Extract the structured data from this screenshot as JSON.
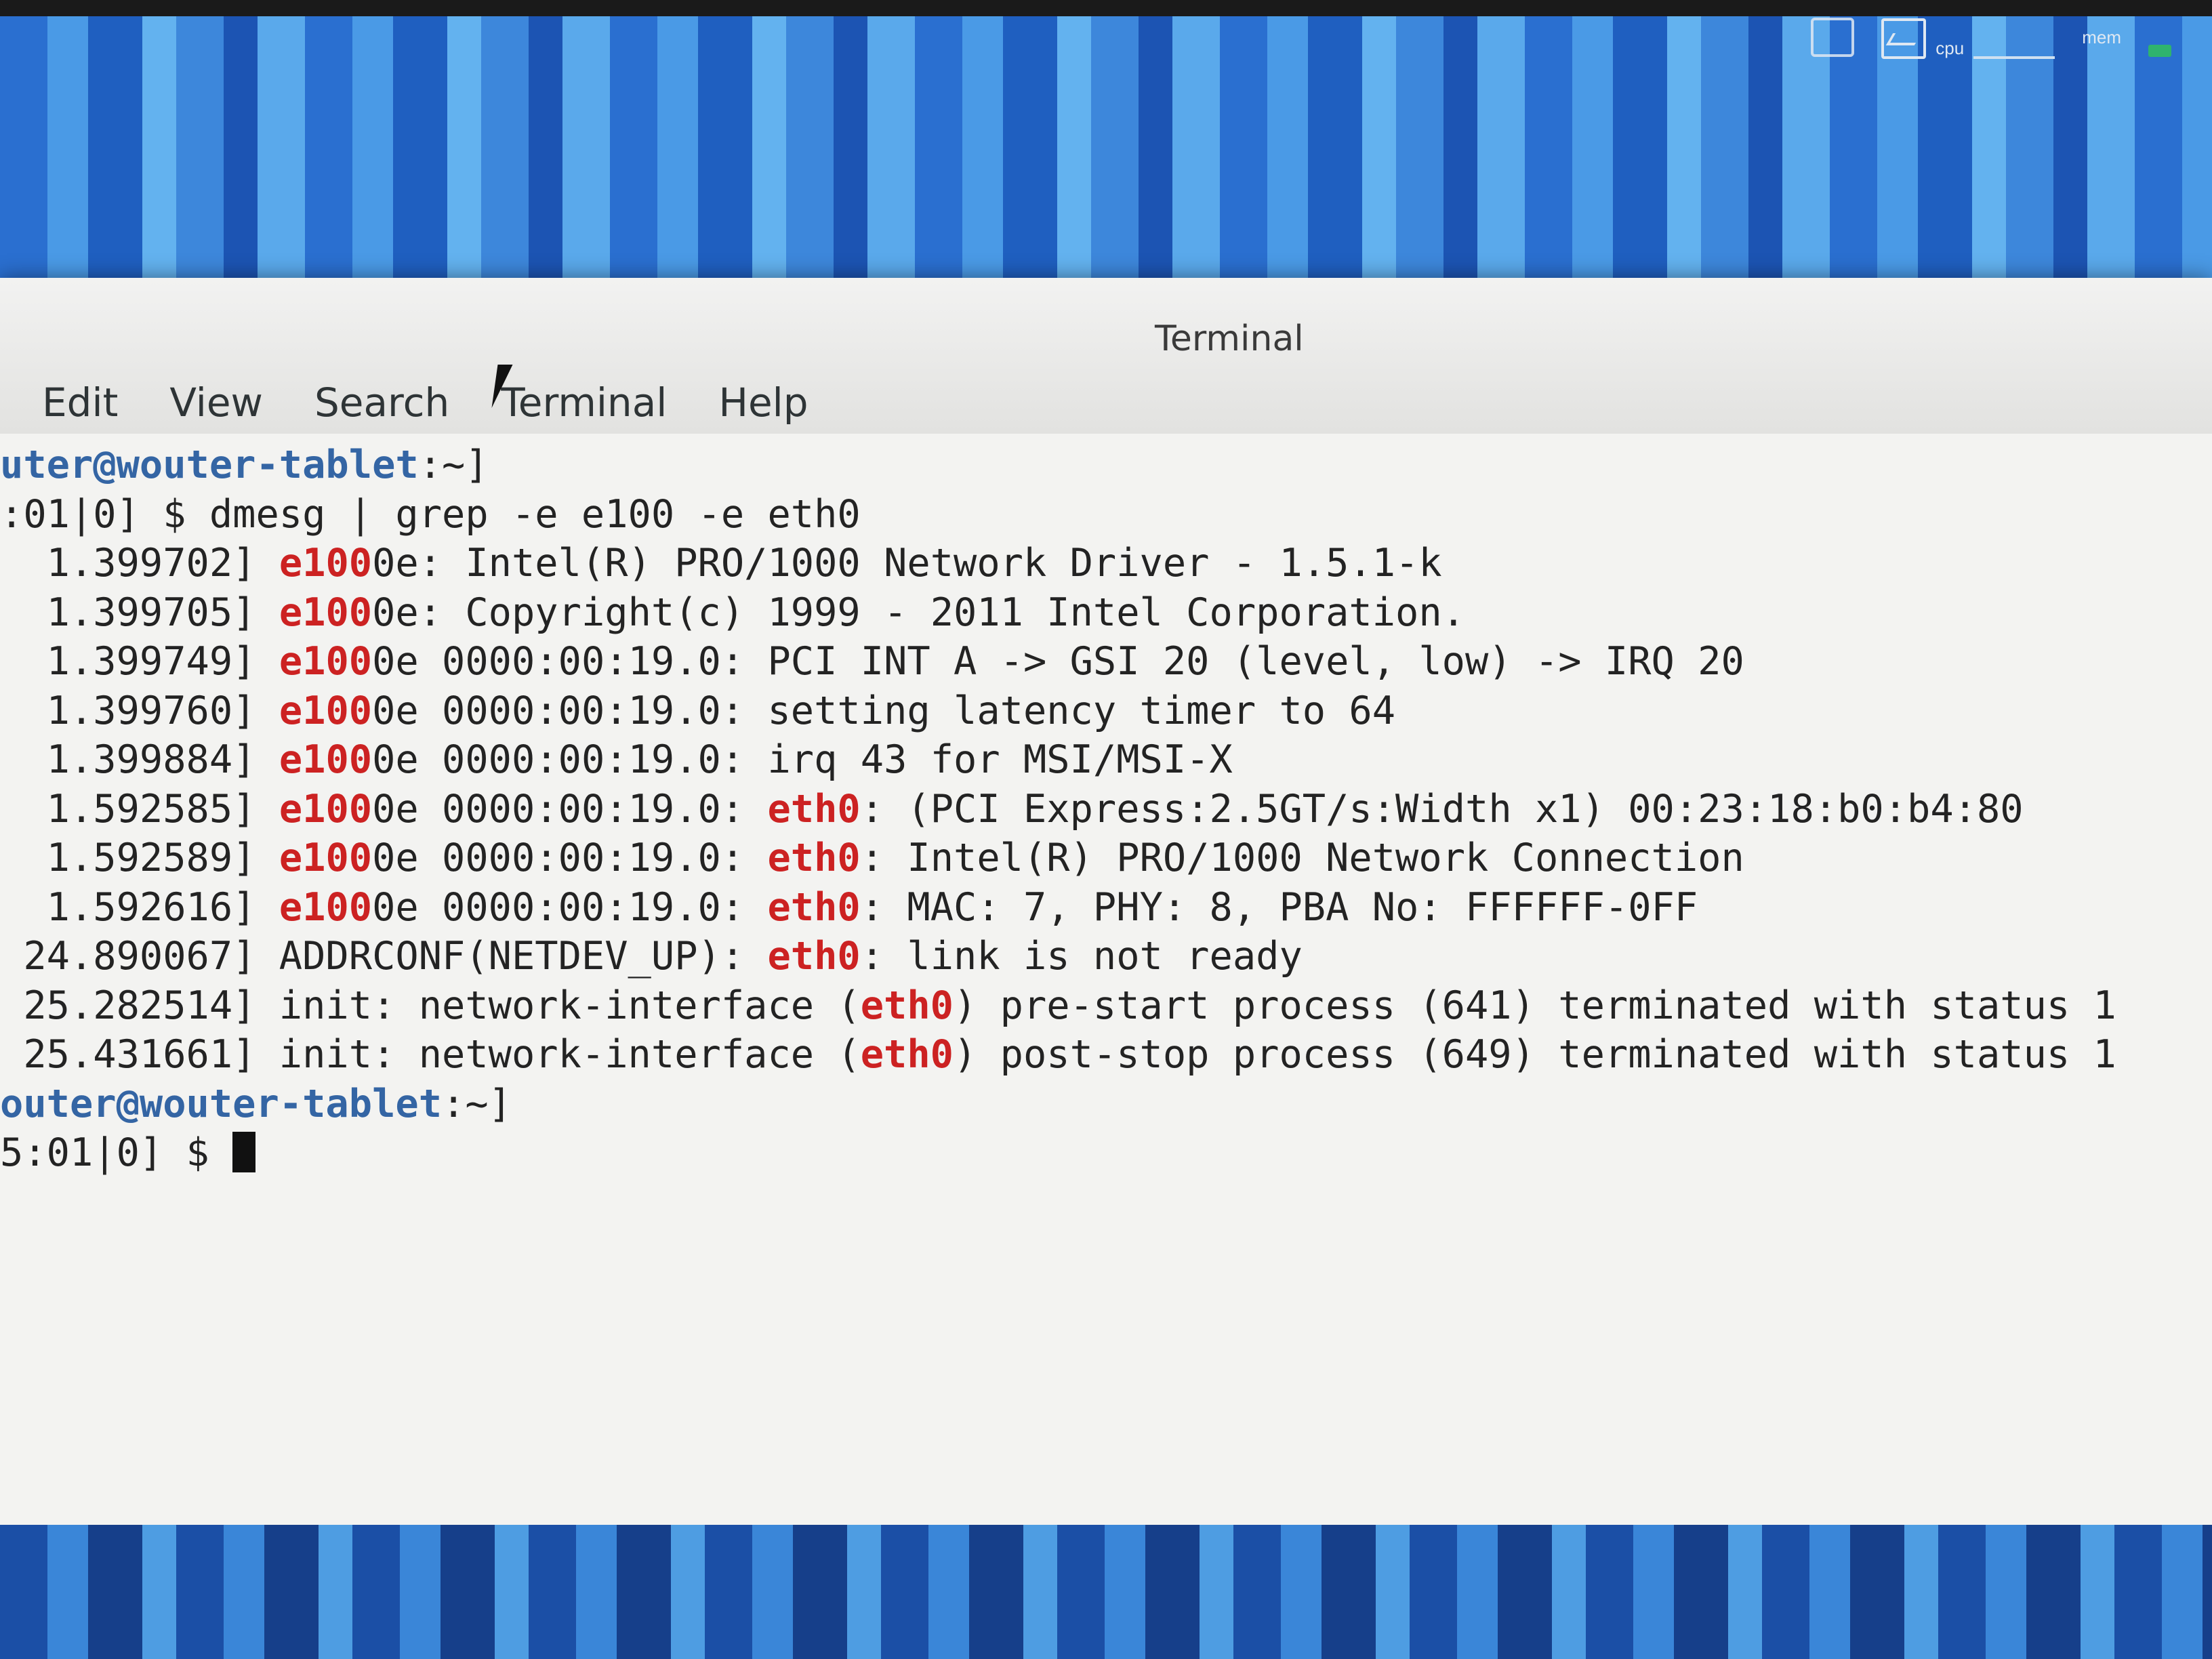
{
  "panel": {
    "cpu_label": "cpu",
    "mem_label": "mem"
  },
  "window": {
    "title": "Terminal"
  },
  "menubar": {
    "items": [
      "Edit",
      "View",
      "Search",
      "Terminal",
      "Help"
    ]
  },
  "terminal": {
    "lines": [
      {
        "segments": [
          {
            "t": "uter@wouter-tablet",
            "c": "user"
          },
          {
            "t": ":~]"
          }
        ]
      },
      {
        "segments": [
          {
            "t": ":01|0] $ dmesg | grep -e e100 -e eth0"
          }
        ]
      },
      {
        "segments": [
          {
            "t": "  1.399702] "
          },
          {
            "t": "e100",
            "c": "hl"
          },
          {
            "t": "0e: Intel(R) PRO/1000 Network Driver - 1.5.1-k"
          }
        ]
      },
      {
        "segments": [
          {
            "t": "  1.399705] "
          },
          {
            "t": "e100",
            "c": "hl"
          },
          {
            "t": "0e: Copyright(c) 1999 - 2011 Intel Corporation."
          }
        ]
      },
      {
        "segments": [
          {
            "t": "  1.399749] "
          },
          {
            "t": "e100",
            "c": "hl"
          },
          {
            "t": "0e 0000:00:19.0: PCI INT A -> GSI 20 (level, low) -> IRQ 20"
          }
        ]
      },
      {
        "segments": [
          {
            "t": "  1.399760] "
          },
          {
            "t": "e100",
            "c": "hl"
          },
          {
            "t": "0e 0000:00:19.0: setting latency timer to 64"
          }
        ]
      },
      {
        "segments": [
          {
            "t": "  1.399884] "
          },
          {
            "t": "e100",
            "c": "hl"
          },
          {
            "t": "0e 0000:00:19.0: irq 43 for MSI/MSI-X"
          }
        ]
      },
      {
        "segments": [
          {
            "t": "  1.592585] "
          },
          {
            "t": "e100",
            "c": "hl"
          },
          {
            "t": "0e 0000:00:19.0: "
          },
          {
            "t": "eth0",
            "c": "hl"
          },
          {
            "t": ": (PCI Express:2.5GT/s:Width x1) 00:23:18:b0:b4:80"
          }
        ]
      },
      {
        "segments": [
          {
            "t": "  1.592589] "
          },
          {
            "t": "e100",
            "c": "hl"
          },
          {
            "t": "0e 0000:00:19.0: "
          },
          {
            "t": "eth0",
            "c": "hl"
          },
          {
            "t": ": Intel(R) PRO/1000 Network Connection"
          }
        ]
      },
      {
        "segments": [
          {
            "t": "  1.592616] "
          },
          {
            "t": "e100",
            "c": "hl"
          },
          {
            "t": "0e 0000:00:19.0: "
          },
          {
            "t": "eth0",
            "c": "hl"
          },
          {
            "t": ": MAC: 7, PHY: 8, PBA No: FFFFFF-0FF"
          }
        ]
      },
      {
        "segments": [
          {
            "t": " 24.890067] ADDRCONF(NETDEV_UP): "
          },
          {
            "t": "eth0",
            "c": "hl"
          },
          {
            "t": ": link is not ready"
          }
        ]
      },
      {
        "segments": [
          {
            "t": " 25.282514] init: network-interface ("
          },
          {
            "t": "eth0",
            "c": "hl"
          },
          {
            "t": ") pre-start process (641) terminated with status 1"
          }
        ]
      },
      {
        "segments": [
          {
            "t": " 25.431661] init: network-interface ("
          },
          {
            "t": "eth0",
            "c": "hl"
          },
          {
            "t": ") post-stop process (649) terminated with status 1"
          }
        ]
      },
      {
        "segments": [
          {
            "t": "outer@wouter-tablet",
            "c": "user"
          },
          {
            "t": ":~]"
          }
        ]
      },
      {
        "segments": [
          {
            "t": "5:01|0] $ "
          }
        ],
        "cursor": true
      }
    ]
  }
}
